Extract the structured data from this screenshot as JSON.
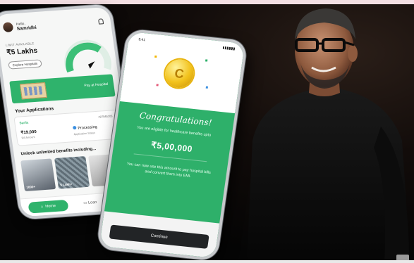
{
  "phone_left": {
    "greeting": "Hello,",
    "user_name": "Samridhi",
    "limit_label": "LIMIT AVAILABLE",
    "limit_value": "₹5 Lakhs",
    "explore_button": "Explore Hospitals",
    "pay_label": "Pay at Hospital",
    "applications_title": "Your Applications",
    "application": {
      "brand": "Surfix",
      "id": "#27045103",
      "amount": "₹19,000",
      "amount_label": "Bill Amount",
      "status": "Processing",
      "status_label": "Application Status"
    },
    "unlock_title": "Unlock unlimited benefits including...",
    "tiles": [
      "1000+",
      "5 Lakh+",
      ""
    ],
    "nav": {
      "home": "Home",
      "loans": "Loan"
    }
  },
  "phone_center": {
    "time": "9:41",
    "coin_glyph": "C",
    "congrats": "Congratulations!",
    "eligible_text": "You are eligible for healthcare benefits upto",
    "amount": "₹5,00,000",
    "description": "You can now use this amount to pay hospital bills and convert them into EMI.",
    "continue_button": "Continue"
  },
  "colors": {
    "brand_green": "#2eb06a",
    "dark_button": "#222426",
    "coin_gold": "#f2c21c"
  }
}
